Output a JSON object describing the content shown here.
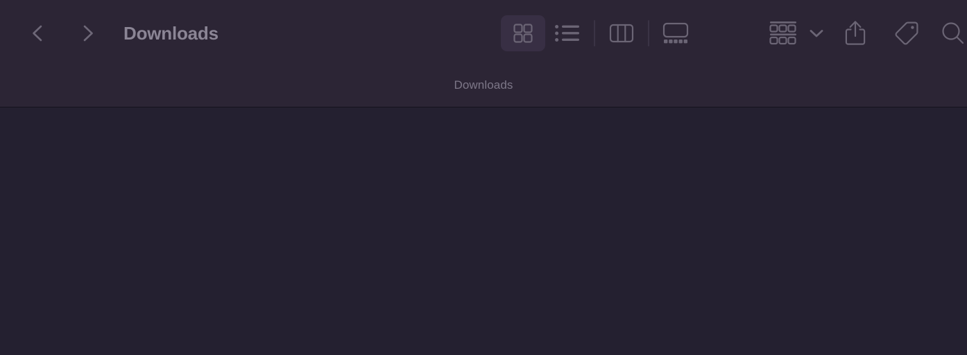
{
  "window": {
    "title": "Downloads",
    "subtitle": "Downloads"
  },
  "colors": {
    "toolbar_bg": "#2c2535",
    "content_bg": "#242030",
    "separator": "#15121c",
    "icon": "#6b6575",
    "title_text": "#8b8595",
    "subtitle_text": "#7d7788",
    "selected_bg": "#382f44"
  },
  "navigation": {
    "back": {
      "icon": "chevron-left-icon",
      "label": "Back"
    },
    "forward": {
      "icon": "chevron-right-icon",
      "label": "Forward"
    }
  },
  "view_switcher": {
    "selected": "icon-view",
    "options": [
      {
        "id": "icon-view",
        "icon": "grid-view-icon",
        "label": "Icon View"
      },
      {
        "id": "list-view",
        "icon": "list-view-icon",
        "label": "List View"
      },
      {
        "id": "column-view",
        "icon": "column-view-icon",
        "label": "Column View"
      },
      {
        "id": "gallery-view",
        "icon": "gallery-view-icon",
        "label": "Gallery View"
      }
    ]
  },
  "actions": [
    {
      "id": "group-by",
      "icon": "group-by-icon",
      "label": "Group"
    },
    {
      "id": "group-menu",
      "icon": "chevron-down-icon",
      "label": "Group Options"
    },
    {
      "id": "share",
      "icon": "share-icon",
      "label": "Share"
    },
    {
      "id": "tags",
      "icon": "tag-icon",
      "label": "Edit Tags"
    },
    {
      "id": "search",
      "icon": "search-icon",
      "label": "Search"
    }
  ],
  "content": {
    "items": [],
    "empty": true
  }
}
